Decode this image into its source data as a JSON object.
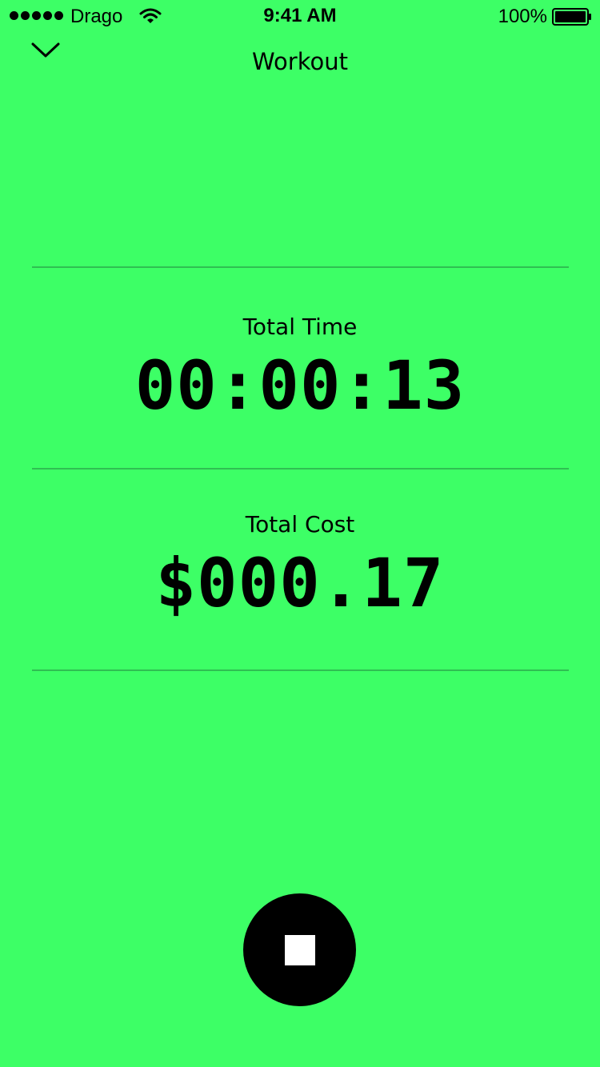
{
  "colors": {
    "background": "#3DFF66",
    "divider": "#2FBF52",
    "foreground": "#000000",
    "stop_icon": "#FFFFFF"
  },
  "status_bar": {
    "carrier": "Drago",
    "time": "9:41 AM",
    "battery": "100%",
    "icons": [
      "signal-dots-icon",
      "wifi-icon",
      "battery-icon"
    ]
  },
  "nav": {
    "title": "Workout",
    "back_icon": "chevron-down-icon"
  },
  "metrics": {
    "time": {
      "label": "Total Time",
      "value": "00:00:13"
    },
    "cost": {
      "label": "Total Cost",
      "value": "$000.17"
    }
  },
  "controls": {
    "stop_icon": "stop-icon"
  }
}
